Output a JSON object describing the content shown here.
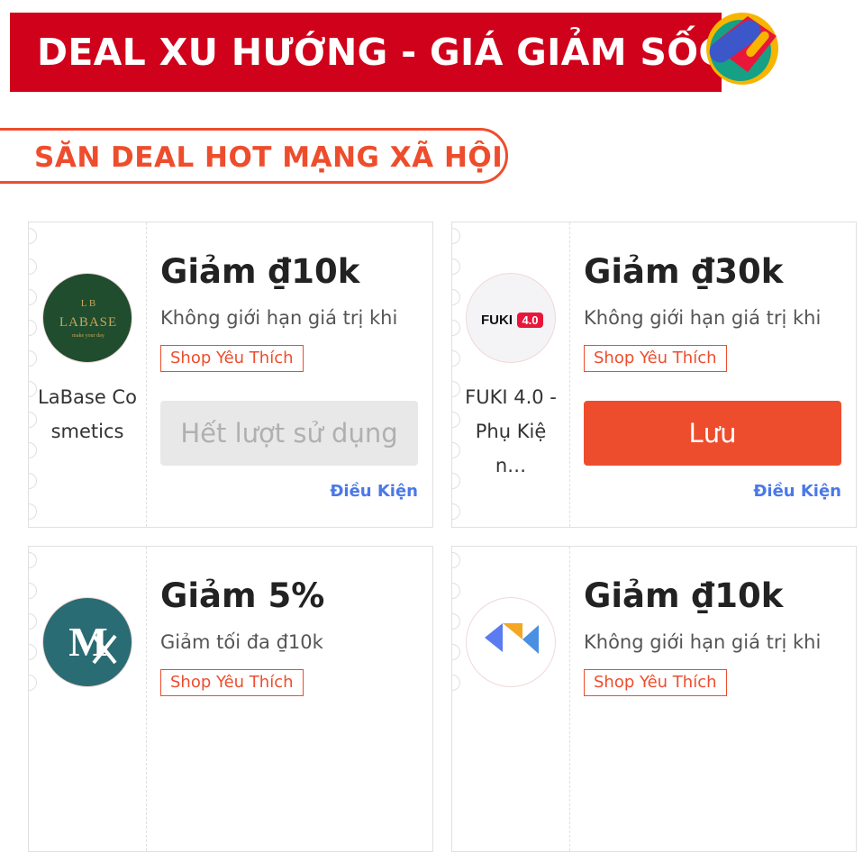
{
  "banner": {
    "title": "DEAL XU HƯỚNG - GIÁ GIẢM SỐC"
  },
  "section": {
    "title": "SĂN DEAL HOT MẠNG XÃ HỘI"
  },
  "vouchers": [
    {
      "shop_name": "LaBase Cosmetics",
      "logo_text": "LABASE",
      "logo_tagline": "make your day",
      "discount": "Giảm ₫10k",
      "description": "Không giới hạn giá trị khi",
      "tag": "Shop Yêu Thích",
      "button": "Hết lượt sử dụng",
      "terms": "Điều Kiện"
    },
    {
      "shop_name": "FUKI 4.0 - Phụ Kiện…",
      "logo_text": "FUKI",
      "logo_badge": "4.0",
      "discount": "Giảm ₫30k",
      "description": "Không giới hạn giá trị khi",
      "tag": "Shop Yêu Thích",
      "button": "Lưu",
      "terms": "Điều Kiện"
    },
    {
      "logo_text": "M",
      "discount": "Giảm 5%",
      "description": "Giảm tối đa ₫10k",
      "tag": "Shop Yêu Thích"
    },
    {
      "discount": "Giảm ₫10k",
      "description": "Không giới hạn giá trị khi",
      "tag": "Shop Yêu Thích"
    }
  ],
  "colors": {
    "banner_red": "#d0011b",
    "accent_orange": "#ee4d2d",
    "link_blue": "#4a78e8"
  }
}
